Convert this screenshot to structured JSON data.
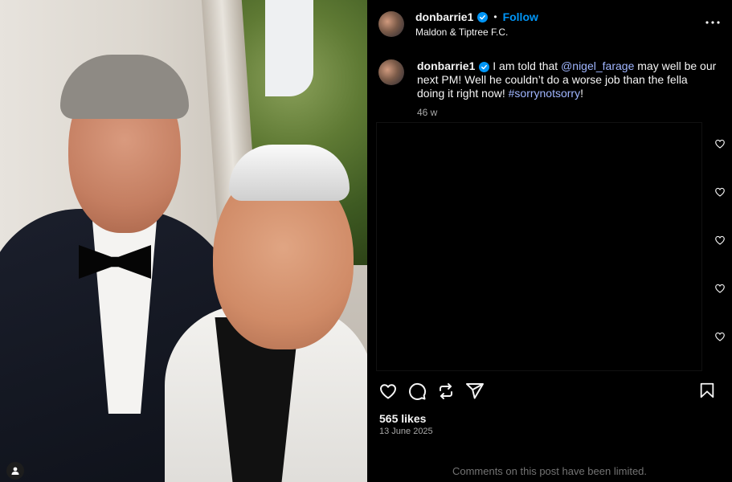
{
  "post": {
    "header": {
      "username": "donbarrie1",
      "dot": "•",
      "follow_label": "Follow",
      "location": "Maldon & Tiptree F.C."
    },
    "caption": {
      "username": "donbarrie1",
      "text_part1": " I am told that ",
      "mention": "@nigel_farage",
      "text_part2": " may well be our next PM! Well he couldn’t do a worse job than the fella doing it right now! ",
      "hashtag": "#sorrynotsorry",
      "text_part3": "!",
      "time": "46 w"
    },
    "likes": "565 likes",
    "date": "13 June 2025",
    "comments_limited": "Comments on this post have been limited."
  },
  "colors": {
    "background": "#000000",
    "accent_blue": "#0095f6",
    "link_blue": "#a0b6ff",
    "secondary_text": "#a8a8a8",
    "muted_text": "#737373"
  },
  "icons": {
    "more": "more-options-icon",
    "like": "heart-icon",
    "comment": "comment-icon",
    "repost": "repost-icon",
    "share": "share-icon",
    "save": "bookmark-icon",
    "verified": "verified-badge-icon",
    "user_tag": "user-tag-icon"
  }
}
